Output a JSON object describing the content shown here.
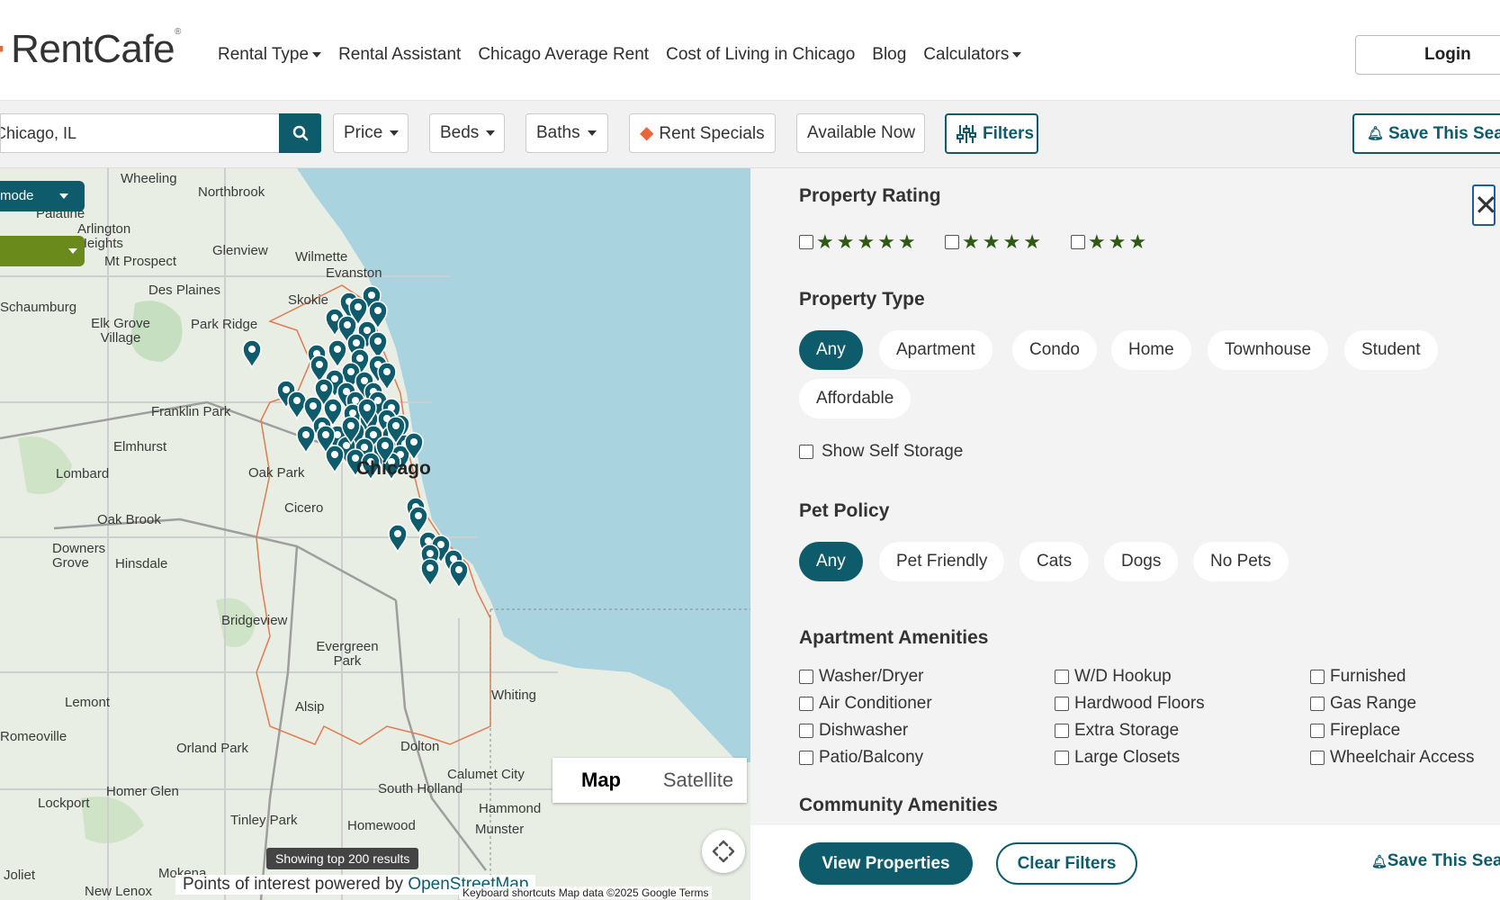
{
  "header": {
    "logo_text": "RentCafe",
    "nav": [
      {
        "label": "Rental Type",
        "dropdown": true
      },
      {
        "label": "Rental Assistant",
        "dropdown": false
      },
      {
        "label": "Chicago Average Rent",
        "dropdown": false
      },
      {
        "label": "Cost of Living in Chicago",
        "dropdown": false
      },
      {
        "label": "Blog",
        "dropdown": false
      },
      {
        "label": "Calculators",
        "dropdown": true
      }
    ],
    "login_label": "Login"
  },
  "search": {
    "location_value": "Chicago, IL",
    "price_label": "Price",
    "beds_label": "Beds",
    "baths_label": "Baths",
    "rent_specials_label": "Rent Specials",
    "available_now_label": "Available Now",
    "filters_label": "Filters",
    "save_search_label": "Save This Search"
  },
  "map": {
    "mode_label": "mode",
    "map_type": {
      "map": "Map",
      "satellite": "Satellite",
      "selected": "Map"
    },
    "results_text": "Showing top 200 results",
    "poi_prefix": "Points of interest powered by ",
    "poi_link": "OpenStreetMap",
    "attribution": "Keyboard shortcuts   Map data ©2025 Google   Terms",
    "places": [
      "Wheeling",
      "Northbrook",
      "Palatine",
      "Arlington Heights",
      "Glenview",
      "Wilmette",
      "Mt Prospect",
      "Evanston",
      "Des Plaines",
      "Skokie",
      "Schaumburg",
      "Park Ridge",
      "Elk Grove Village",
      "Franklin Park",
      "Elmhurst",
      "Lombard",
      "Oak Park",
      "Chicago",
      "Cicero",
      "Oak Brook",
      "Downers Grove",
      "Hinsdale",
      "Bridgeview",
      "Evergreen Park",
      "Lemont",
      "Alsip",
      "Whiting",
      "Orland Park",
      "Dolton",
      "Calumet City",
      "Homer Glen",
      "South Holland",
      "Hammond",
      "Lockport",
      "Tinley Park",
      "Homewood",
      "Munster",
      "Joliet",
      "Mokena",
      "New Lenox",
      "Romeoville"
    ],
    "colors": {
      "water": "#a9d3df",
      "land": "#e9eee4",
      "pin": "#0e5c6b"
    }
  },
  "filters_panel": {
    "close_label": "✕",
    "property_rating": {
      "title": "Property Rating",
      "options": [
        {
          "stars": 5
        },
        {
          "stars": 4
        },
        {
          "stars": 3
        }
      ]
    },
    "property_type": {
      "title": "Property Type",
      "options": [
        "Any",
        "Apartment",
        "Condo",
        "Home",
        "Townhouse",
        "Student",
        "Affordable"
      ],
      "selected": "Any",
      "self_storage_label": "Show Self Storage"
    },
    "pet_policy": {
      "title": "Pet Policy",
      "options": [
        "Any",
        "Pet Friendly",
        "Cats",
        "Dogs",
        "No Pets"
      ],
      "selected": "Any"
    },
    "apartment_amenities": {
      "title": "Apartment Amenities",
      "items": [
        "Washer/Dryer",
        "W/D Hookup",
        "Furnished",
        "Air Conditioner",
        "Hardwood Floors",
        "Gas Range",
        "Dishwasher",
        "Extra Storage",
        "Fireplace",
        "Patio/Balcony",
        "Large Closets",
        "Wheelchair Access"
      ]
    },
    "community_amenities": {
      "title": "Community Amenities"
    }
  },
  "footer": {
    "view_label": "View Properties",
    "clear_label": "Clear Filters",
    "save_label": "Save This Search"
  },
  "colors": {
    "brand": "#0e5c6b",
    "accent": "#e8663a",
    "star": "#2e5a14"
  }
}
